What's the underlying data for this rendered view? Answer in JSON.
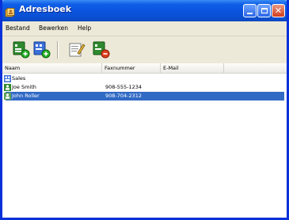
{
  "window": {
    "title": "Adresboek",
    "icon": "address-book-icon",
    "controls": [
      "minimize-icon",
      "maximize-icon",
      "close-icon"
    ],
    "accent_color": "#0a54dd",
    "selection_color": "#316ac5"
  },
  "menu": {
    "items": [
      {
        "label": "Bestand"
      },
      {
        "label": "Bewerken"
      },
      {
        "label": "Help"
      }
    ]
  },
  "toolbar": {
    "buttons": [
      {
        "icon": "new-contact-icon"
      },
      {
        "icon": "new-group-icon"
      },
      {
        "icon": "edit-icon"
      },
      {
        "icon": "delete-icon"
      }
    ]
  },
  "list": {
    "columns": [
      {
        "label": "Naam"
      },
      {
        "label": "Faxnummer"
      },
      {
        "label": "E-Mail"
      }
    ],
    "rows": [
      {
        "icon": "group-icon",
        "name": "Sales",
        "fax": "",
        "email": "",
        "selected": false
      },
      {
        "icon": "contact-icon",
        "name": "Joe Smith",
        "fax": "908-555-1234",
        "email": "",
        "selected": false
      },
      {
        "icon": "contact-icon",
        "name": "John Roller",
        "fax": "908-704-2312",
        "email": "",
        "selected": true
      }
    ]
  }
}
